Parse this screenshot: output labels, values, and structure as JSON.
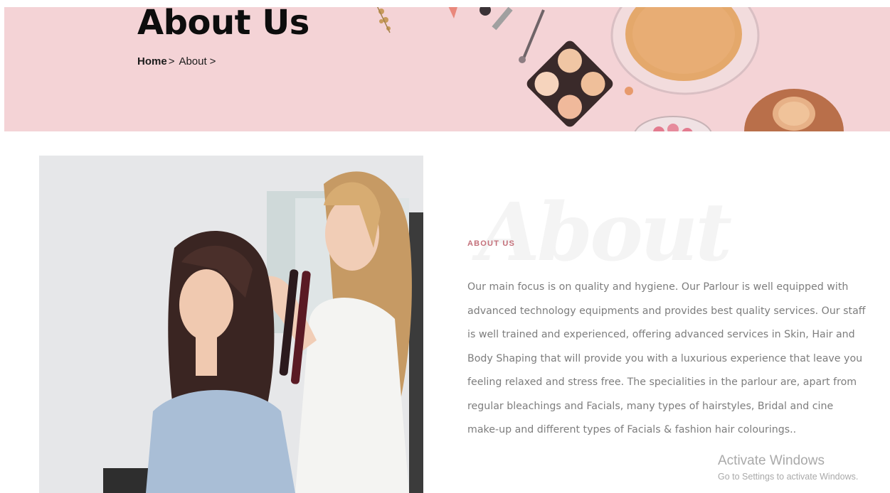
{
  "hero": {
    "title": "About Us",
    "breadcrumb": {
      "home": "Home",
      "about": "About",
      "separator": ">"
    }
  },
  "photo": {
    "description_icon": "salon-photo"
  },
  "about": {
    "watermark": "About",
    "label": "ABOUT US",
    "text": "Our main focus is on quality and hygiene. Our Parlour is well equipped with advanced technology equipments and provides best quality services. Our staff is well trained and experienced, offering advanced services in Skin, Hair and Body Shaping that will provide you with a luxurious experience that leave you feeling relaxed and stress free. The specialities in the parlour are, apart from regular bleachings and Facials, many types of hairstyles, Bridal and cine make-up and different types of Facials & fashion hair colourings.."
  },
  "windows_notice": {
    "title": "Activate Windows",
    "subtitle": "Go to Settings to activate Windows."
  },
  "colors": {
    "hero_bg": "#f4d3d6",
    "accent": "#c4707a",
    "body_text": "#7d7d7d"
  }
}
